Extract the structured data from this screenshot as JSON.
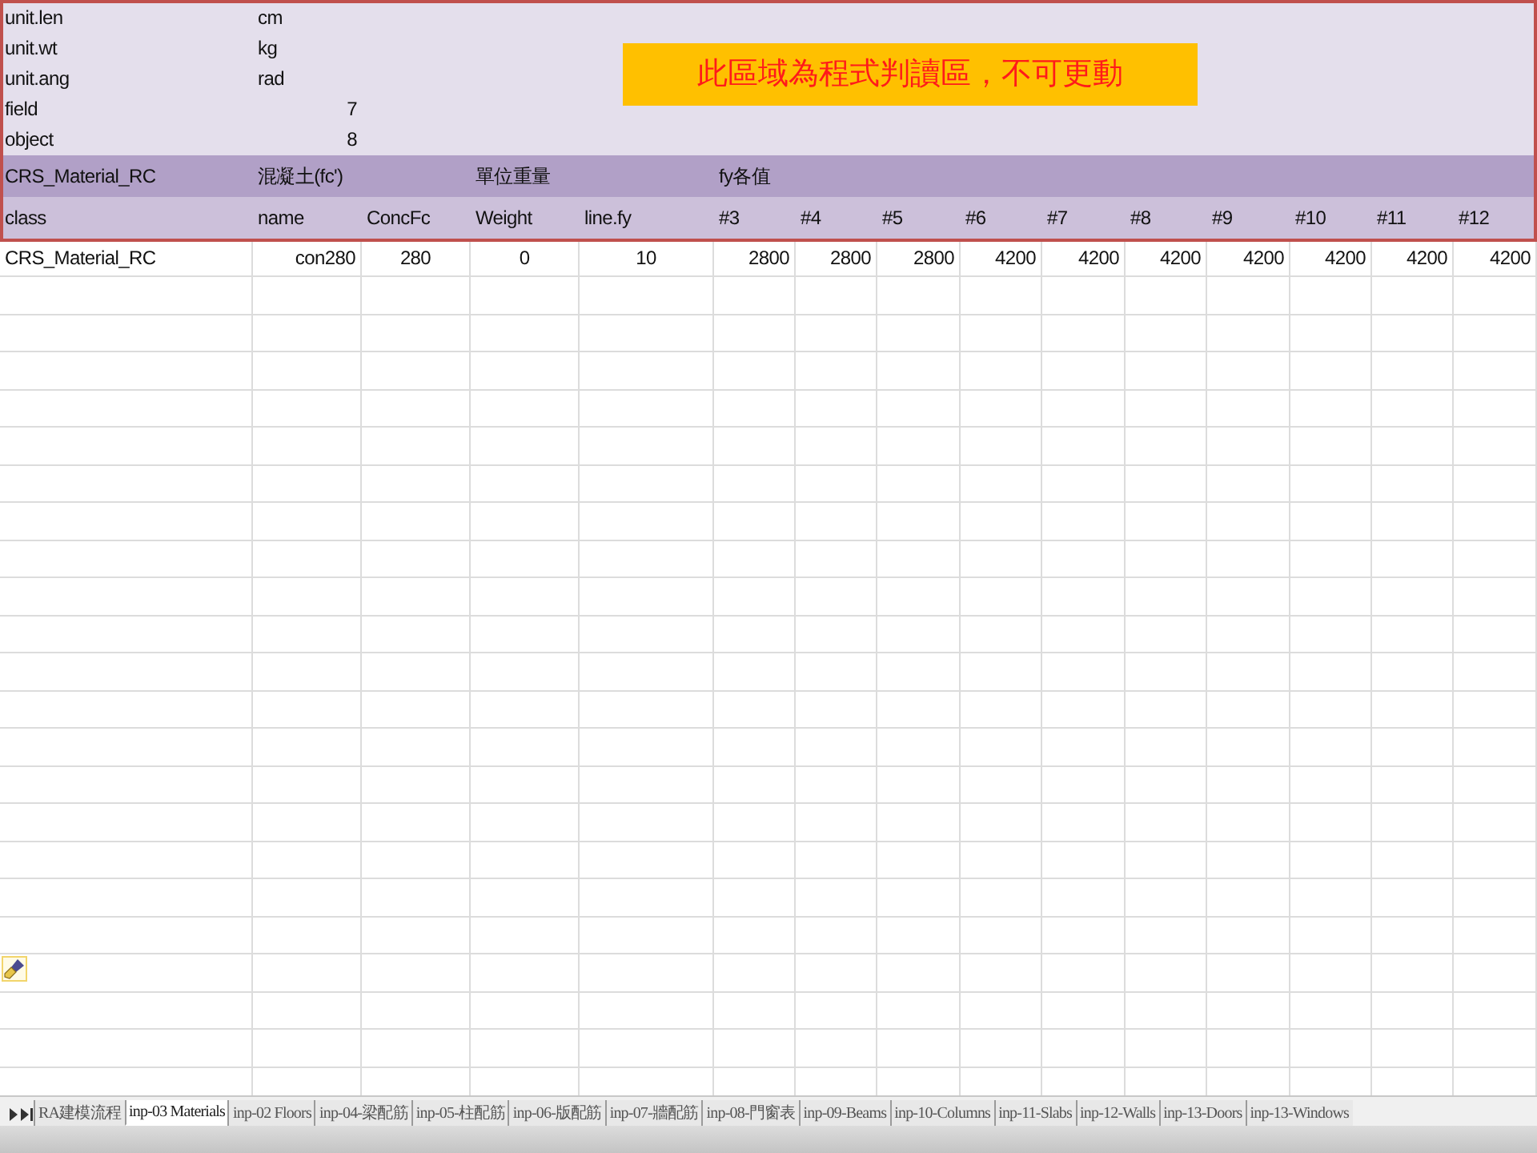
{
  "meta": [
    {
      "label": "unit.len",
      "value": "cm",
      "kind": "text"
    },
    {
      "label": "unit.wt",
      "value": "kg",
      "kind": "text"
    },
    {
      "label": "unit.ang",
      "value": "rad",
      "kind": "text"
    },
    {
      "label": "field",
      "value": "7",
      "kind": "number"
    },
    {
      "label": "object",
      "value": "8",
      "kind": "number"
    }
  ],
  "notice": "此區域為程式判讀區，不可更動",
  "table": {
    "columns": [
      {
        "name": "class",
        "group": "CRS_Material_RC"
      },
      {
        "name": "name",
        "group": "混凝土(fc')"
      },
      {
        "name": "ConcFc"
      },
      {
        "name": "Weight",
        "group": "單位重量"
      },
      {
        "name": "line.fy"
      },
      {
        "name": "#3",
        "group": "fy各值"
      },
      {
        "name": "#4"
      },
      {
        "name": "#5"
      },
      {
        "name": "#6"
      },
      {
        "name": "#7"
      },
      {
        "name": "#8"
      },
      {
        "name": "#9"
      },
      {
        "name": "#10"
      },
      {
        "name": "#11"
      },
      {
        "name": "#12"
      }
    ],
    "rows": [
      {
        "cells": [
          "CRS_Material_RC",
          "con280",
          "280",
          "0",
          "10",
          "2800",
          "2800",
          "2800",
          "4200",
          "4200",
          "4200",
          "4200",
          "4200",
          "4200",
          "4200"
        ]
      }
    ]
  },
  "sheet_tabs": [
    {
      "label": "RA建模流程",
      "selected": false
    },
    {
      "label": "inp-03 Materials",
      "selected": true
    },
    {
      "label": "inp-02 Floors",
      "selected": false
    },
    {
      "label": "inp-04-梁配筋",
      "selected": false
    },
    {
      "label": "inp-05-柱配筋",
      "selected": false
    },
    {
      "label": "inp-06-版配筋",
      "selected": false
    },
    {
      "label": "inp-07-牆配筋",
      "selected": false
    },
    {
      "label": "inp-08-門窗表",
      "selected": false
    },
    {
      "label": "inp-09-Beams",
      "selected": false
    },
    {
      "label": "inp-10-Columns",
      "selected": false
    },
    {
      "label": "inp-11-Slabs",
      "selected": false
    },
    {
      "label": "inp-12-Walls",
      "selected": false
    },
    {
      "label": "inp-13-Doors",
      "selected": false
    },
    {
      "label": "inp-13-Windows",
      "selected": false
    }
  ]
}
